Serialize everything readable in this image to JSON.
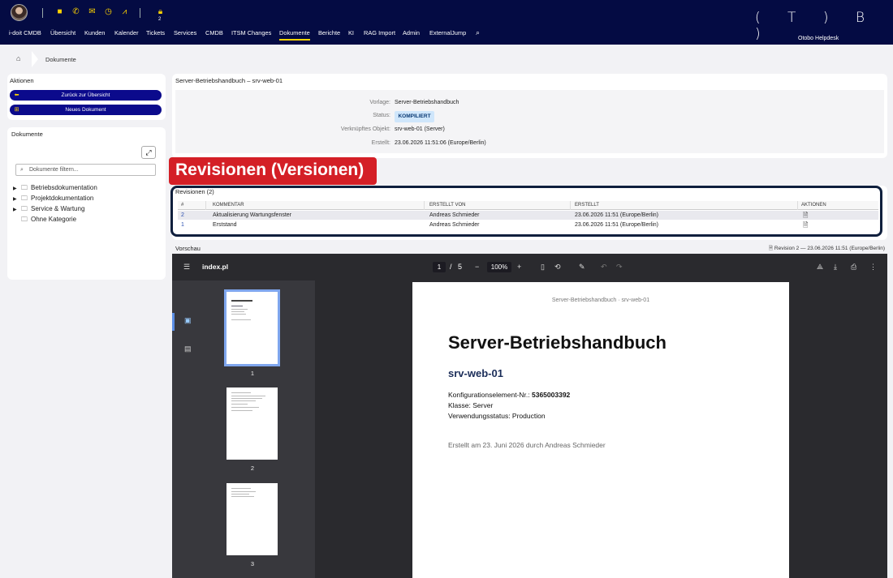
{
  "nav": {
    "lock_count": "2",
    "menu": [
      "i-doit CMDB",
      "Übersicht",
      "Kunden",
      "Kalender",
      "Tickets",
      "Services",
      "CMDB",
      "ITSM Changes",
      "Dokumente",
      "Berichte",
      "KI",
      "RAG Import",
      "Admin",
      "ExternalJump"
    ],
    "logo": "( T ) B )",
    "logo_sub": "Otobo Helpdesk"
  },
  "breadcrumb": {
    "current": "Dokumente"
  },
  "actions": {
    "title": "Aktionen",
    "back": "Zurück zur Übersicht",
    "new_doc": "Neues Dokument"
  },
  "documents": {
    "title": "Dokumente",
    "filter_placeholder": "Dokumente filtern...",
    "tree": [
      "Betriebsdokumentation",
      "Projektdokumentation",
      "Service & Wartung",
      "Ohne Kategorie"
    ]
  },
  "detail": {
    "title": "Server-Betriebshandbuch – srv-web-01",
    "vorlage_label": "Vorlage:",
    "vorlage": "Server-Betriebshandbuch",
    "status_label": "Status:",
    "status": "KOMPILIERT",
    "objekt_label": "Verknüpftes Objekt:",
    "objekt": "srv-web-01 (Server)",
    "erstellt_label": "Erstellt:",
    "erstellt": "23.06.2026 11:51:06 (Europe/Berlin)"
  },
  "annotation": "Revisionen (Versionen)",
  "revisions": {
    "title": "Revisionen (2)",
    "headers": {
      "num": "#",
      "kommentar": "KOMMENTAR",
      "von": "ERSTELLT VON",
      "erstellt": "ERSTELLT",
      "aktionen": "AKTIONEN"
    },
    "rows": [
      {
        "num": "2",
        "kommentar": "Aktualisierung Wartungsfenster",
        "von": "Andreas Schmieder",
        "erstellt": "23.06.2026 11:51 (Europe/Berlin)"
      },
      {
        "num": "1",
        "kommentar": "Erststand",
        "von": "Andreas Schmieder",
        "erstellt": "23.06.2026 11:51 (Europe/Berlin)"
      }
    ]
  },
  "preview": {
    "title": "Vorschau",
    "meta": "Revision 2 — 23.06.2026 11:51 (Europe/Berlin)"
  },
  "viewer": {
    "filename": "index.pl",
    "page": "1",
    "total": "5",
    "zoom": "100%",
    "thumb_labels": [
      "1",
      "2",
      "3"
    ]
  },
  "pdf": {
    "header": "Server-Betriebshandbuch · srv-web-01",
    "title": "Server-Betriebshandbuch",
    "subtitle": "srv-web-01",
    "ci_label": "Konfigurationselement-Nr.: ",
    "ci_value": "5365003392",
    "klasse": "Klasse: Server",
    "status": "Verwendungsstatus: Production",
    "note": "Erstellt am 23. Juni 2026 durch Andreas Schmieder"
  },
  "colors": {
    "nav_bg": "#040b43",
    "accent": "#ffd400",
    "button_bg": "#0b0a8c",
    "annotation": "#d41f26"
  }
}
